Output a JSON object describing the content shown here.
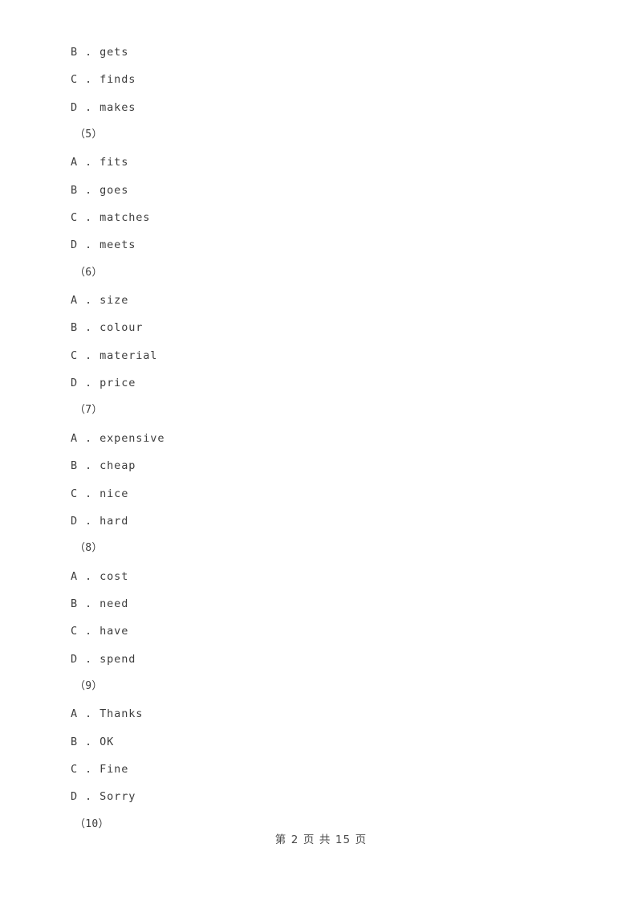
{
  "document": {
    "type": "exam-paper",
    "background_color": "#ffffff",
    "text_color": "#3d3d3d"
  },
  "lines": [
    {
      "kind": "option",
      "text": "B . gets"
    },
    {
      "kind": "option",
      "text": "C . finds"
    },
    {
      "kind": "option",
      "text": "D . makes"
    },
    {
      "kind": "qnum",
      "text": "（5）"
    },
    {
      "kind": "option",
      "text": "A . fits"
    },
    {
      "kind": "option",
      "text": "B . goes"
    },
    {
      "kind": "option",
      "text": "C . matches"
    },
    {
      "kind": "option",
      "text": "D . meets"
    },
    {
      "kind": "qnum",
      "text": "（6）"
    },
    {
      "kind": "option",
      "text": "A . size"
    },
    {
      "kind": "option",
      "text": "B . colour"
    },
    {
      "kind": "option",
      "text": "C . material"
    },
    {
      "kind": "option",
      "text": "D . price"
    },
    {
      "kind": "qnum",
      "text": "（7）"
    },
    {
      "kind": "option",
      "text": "A . expensive"
    },
    {
      "kind": "option",
      "text": "B . cheap"
    },
    {
      "kind": "option",
      "text": "C . nice"
    },
    {
      "kind": "option",
      "text": "D . hard"
    },
    {
      "kind": "qnum",
      "text": "（8）"
    },
    {
      "kind": "option",
      "text": "A . cost"
    },
    {
      "kind": "option",
      "text": "B . need"
    },
    {
      "kind": "option",
      "text": "C . have"
    },
    {
      "kind": "option",
      "text": "D . spend"
    },
    {
      "kind": "qnum",
      "text": "（9）"
    },
    {
      "kind": "option",
      "text": "A . Thanks"
    },
    {
      "kind": "option",
      "text": "B . OK"
    },
    {
      "kind": "option",
      "text": "C . Fine"
    },
    {
      "kind": "option",
      "text": "D . Sorry"
    },
    {
      "kind": "qnum",
      "text": "（10）"
    }
  ],
  "footer": {
    "page_label": "第 2 页 共 15 页",
    "current_page": 2,
    "total_pages": 15
  }
}
